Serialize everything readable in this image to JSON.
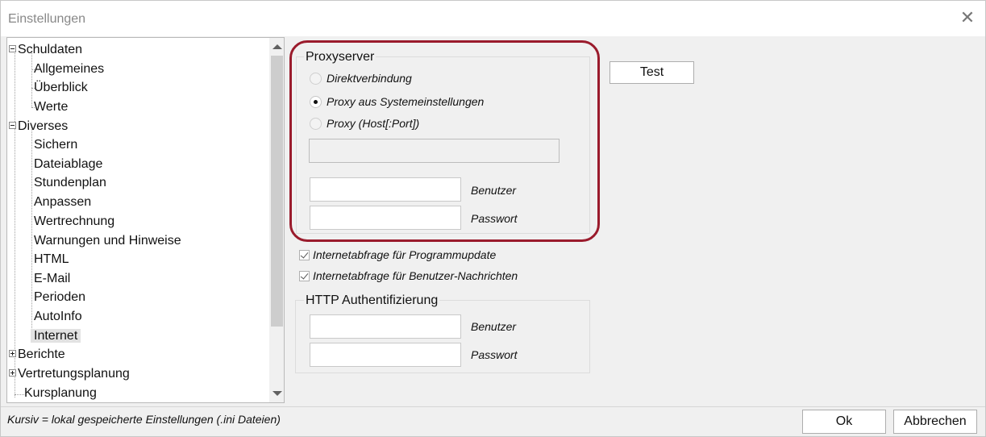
{
  "window": {
    "title": "Einstellungen",
    "close_icon": "close-icon"
  },
  "tree": {
    "items": [
      {
        "label": "Schuldaten",
        "level": 0,
        "expander": "minus"
      },
      {
        "label": "Allgemeines",
        "level": 1
      },
      {
        "label": "Überblick",
        "level": 1
      },
      {
        "label": "Werte",
        "level": 1
      },
      {
        "label": "Diverses",
        "level": 0,
        "expander": "minus"
      },
      {
        "label": "Sichern",
        "level": 1
      },
      {
        "label": "Dateiablage",
        "level": 1
      },
      {
        "label": "Stundenplan",
        "level": 1
      },
      {
        "label": "Anpassen",
        "level": 1
      },
      {
        "label": "Wertrechnung",
        "level": 1
      },
      {
        "label": "Warnungen und Hinweise",
        "level": 1
      },
      {
        "label": "HTML",
        "level": 1
      },
      {
        "label": "E-Mail",
        "level": 1
      },
      {
        "label": "Perioden",
        "level": 1
      },
      {
        "label": "AutoInfo",
        "level": 1
      },
      {
        "label": "Internet",
        "level": 1,
        "selected": true
      },
      {
        "label": "Berichte",
        "level": 0,
        "expander": "plus"
      },
      {
        "label": "Vertretungsplanung",
        "level": 0,
        "expander": "plus"
      },
      {
        "label": "Kursplanung",
        "level": 0
      }
    ]
  },
  "proxy": {
    "legend": "Proxyserver",
    "options": [
      {
        "label": "Direktverbindung",
        "selected": false
      },
      {
        "label": "Proxy aus Systemeinstellungen",
        "selected": true
      },
      {
        "label": "Proxy (Host[:Port])",
        "selected": false
      }
    ],
    "host_value": "",
    "user_label": "Benutzer",
    "user_value": "",
    "password_label": "Passwort",
    "password_value": "",
    "highlight_color": "#9a1b2c"
  },
  "test_button": "Test",
  "checkboxes": [
    {
      "label": "Internetabfrage für Programmupdate",
      "checked": true
    },
    {
      "label": "Internetabfrage für Benutzer-Nachrichten",
      "checked": true
    }
  ],
  "http_auth": {
    "legend": "HTTP Authentifizierung",
    "user_label": "Benutzer",
    "user_value": "",
    "password_label": "Passwort",
    "password_value": ""
  },
  "status": {
    "text": "Kursiv = lokal gespeicherte Einstellungen (.ini Dateien)"
  },
  "buttons": {
    "ok": "Ok",
    "cancel": "Abbrechen"
  }
}
